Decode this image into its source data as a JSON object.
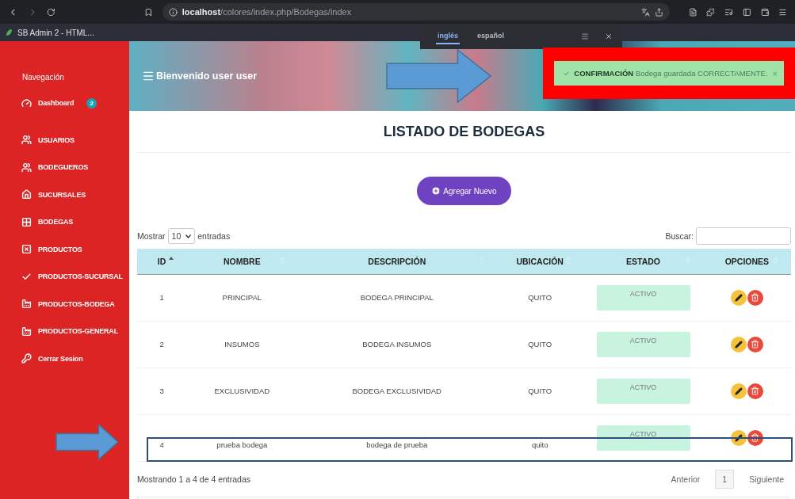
{
  "browser": {
    "url": "**localhost**/colores/index.php/Bodegas/index",
    "tab_title": "SB Admin 2 - HTML...",
    "translate_popup": {
      "languages": [
        {
          "label": "inglés",
          "selected": true
        },
        {
          "label": "español",
          "selected": false
        }
      ]
    }
  },
  "sidebar": {
    "heading": "Navegación",
    "items": [
      {
        "label": "Dashboard",
        "kind": "gauge",
        "badge": "2"
      },
      {
        "label": "USUARIOS",
        "kind": "users"
      },
      {
        "label": "BODEGUEROS",
        "kind": "users"
      },
      {
        "label": "SUCURSALES",
        "kind": "home"
      },
      {
        "label": "BODEGAS",
        "kind": "grid"
      },
      {
        "label": "PRODUCTOS",
        "kind": "boxx"
      },
      {
        "label": "PRODUCTOS-SUCURSAL",
        "kind": "check"
      },
      {
        "label": "PRODUCTOS-BODEGA",
        "kind": "factory"
      },
      {
        "label": "PRODUCTOS-GENERAL",
        "kind": "factory"
      },
      {
        "label": "Cerrar Sesion",
        "kind": "key"
      }
    ]
  },
  "header": {
    "title": "Bienvenido user user"
  },
  "toast": {
    "title": "CONFIRMACIÓN",
    "message": "Bodega guardada CORRECTAMENTE.",
    "close": "×"
  },
  "page": {
    "title": "LISTADO DE BODEGAS",
    "add_button": "Agregar Nuevo"
  },
  "table_controls": {
    "show_label": "Mostrar",
    "page_size": "10",
    "entries_label": "entradas",
    "search_label": "Buscar:"
  },
  "table": {
    "columns": [
      {
        "label": "ID",
        "sorted": true
      },
      {
        "label": "NOMBRE",
        "sorted": false
      },
      {
        "label": "DESCRIPCIÓN",
        "sorted": false
      },
      {
        "label": "UBICACIÓN",
        "sorted": false
      },
      {
        "label": "ESTADO",
        "sorted": false
      },
      {
        "label": "OPCIONES",
        "sorted": false
      }
    ],
    "rows": [
      {
        "id": "1",
        "nombre": "PRINCIPAL",
        "descripcion": "BODEGA PRINCIPAL",
        "ubicacion": "QUITO",
        "estado": "ACTIVO",
        "highlighted": false
      },
      {
        "id": "2",
        "nombre": "INSUMOS",
        "descripcion": "BODEGA INSUMOS",
        "ubicacion": "QUITO",
        "estado": "ACTIVO",
        "highlighted": false
      },
      {
        "id": "3",
        "nombre": "EXCLUSIVIDAD",
        "descripcion": "BODEGA EXCLUSIVIDAD",
        "ubicacion": "QUITO",
        "estado": "ACTIVO",
        "highlighted": false
      },
      {
        "id": "4",
        "nombre": "prueba bodega",
        "descripcion": "bodega de prueba",
        "ubicacion": "quito",
        "estado": "ACTIVO",
        "highlighted": true
      }
    ]
  },
  "footer": {
    "info": "Mostrando 1 a 4 de 4 entradas",
    "pagination": [
      {
        "label": "Anterior",
        "selected": false
      },
      {
        "label": "1",
        "selected": true
      },
      {
        "label": "Siguiente",
        "selected": false
      }
    ]
  }
}
